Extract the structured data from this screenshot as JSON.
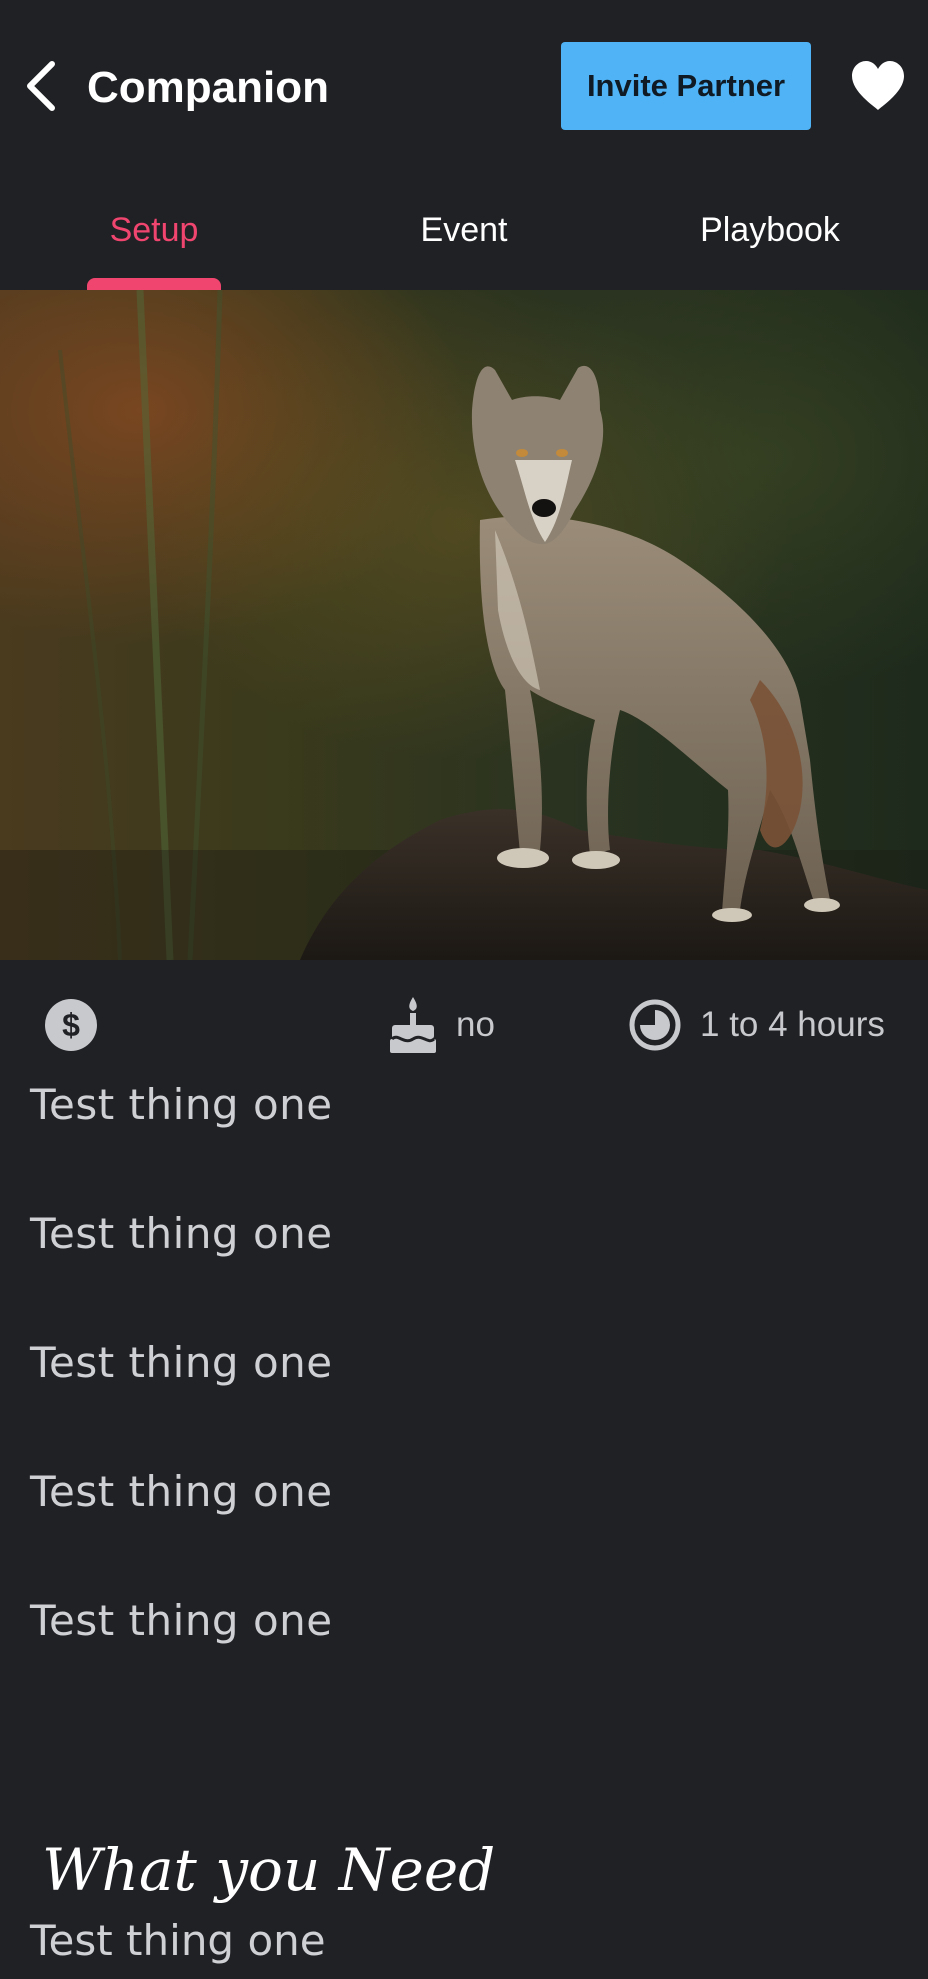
{
  "header": {
    "title": "Companion",
    "invite_label": "Invite Partner",
    "back_icon": "chevron-left-icon",
    "favorite_icon": "heart-icon"
  },
  "tabs": [
    {
      "label": "Setup",
      "active": true
    },
    {
      "label": "Event",
      "active": false
    },
    {
      "label": "Playbook",
      "active": false
    }
  ],
  "colors": {
    "background": "#202125",
    "accent": "#f0456f",
    "invite_button": "#4fb3f5",
    "muted_text": "#c8c9cc"
  },
  "info": {
    "cost_icon": "dollar-icon",
    "occasion_icon": "birthday-cake-icon",
    "occasion_value": "no",
    "duration_icon": "clock-icon",
    "duration_value": "1 to 4 hours"
  },
  "items": [
    "Test thing one",
    "Test thing one",
    "Test thing one",
    "Test thing one",
    "Test thing one"
  ],
  "need": {
    "title": "What you Need",
    "items": [
      "Test thing one"
    ]
  }
}
